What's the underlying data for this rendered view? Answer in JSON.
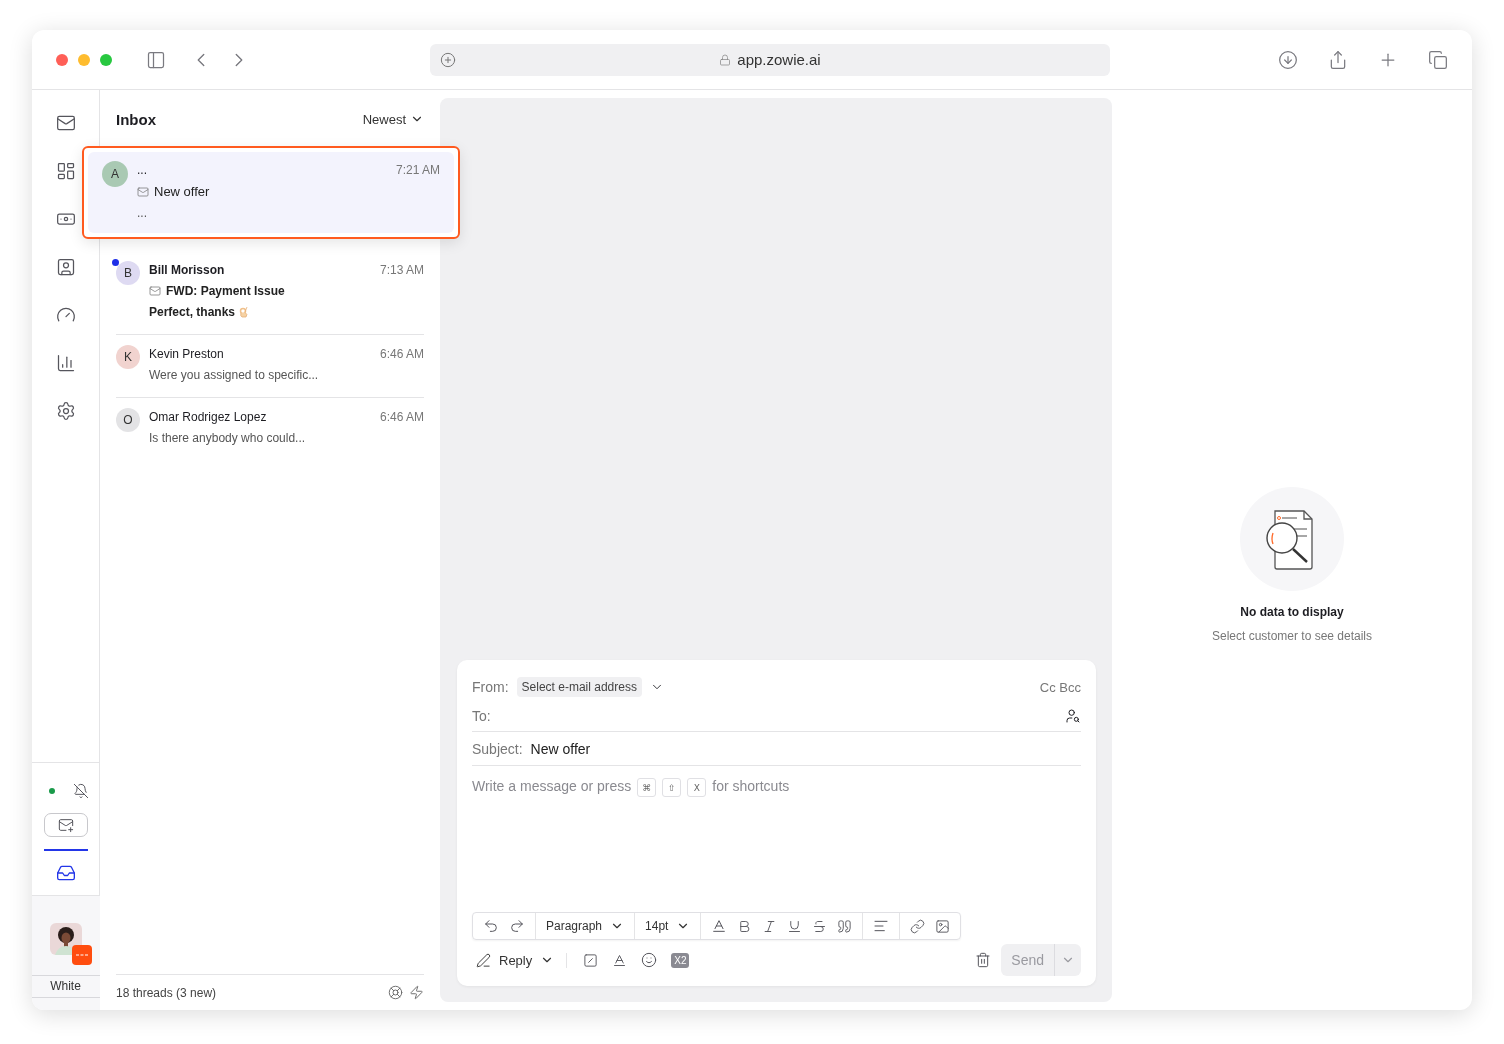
{
  "browser": {
    "url": "app.zowie.ai"
  },
  "rail": {
    "online": true,
    "inbox_tab": {
      "selected": true
    },
    "user": {
      "name": "White"
    }
  },
  "inbox": {
    "title": "Inbox",
    "sort": "Newest",
    "threads": [
      {
        "initial": "A",
        "color": "#a9c9b3",
        "name": "...",
        "subject": "New offer",
        "preview": "...",
        "time": "7:21 AM",
        "selected": true,
        "unread": false
      },
      {
        "initial": "B",
        "color": "#dedaf2",
        "name": "Bill Morisson",
        "subject": "FWD: Payment Issue",
        "preview": "Perfect, thanks",
        "time": "7:13 AM",
        "selected": false,
        "unread": true
      },
      {
        "initial": "K",
        "color": "#f1d3cf",
        "name": "Kevin Preston",
        "preview": "Were you assigned to specific...",
        "time": "6:46 AM",
        "selected": false,
        "unread": false
      },
      {
        "initial": "O",
        "color": "#e3e3e5",
        "name": "Omar Rodrigez Lopez",
        "preview": "Is there anybody who could...",
        "time": "6:46 AM",
        "selected": false,
        "unread": false
      }
    ],
    "footer": "18 threads (3 new)"
  },
  "composer": {
    "from_label": "From:",
    "from_placeholder": "Select e-mail address",
    "cc": "Cc",
    "bcc": "Bcc",
    "to_label": "To:",
    "subject_label": "Subject:",
    "subject": "New offer",
    "body_placeholder": "Write a message or press",
    "keys": [
      "⌘",
      "⇧",
      "X"
    ],
    "body_placeholder_after": "for shortcuts",
    "block_style": "Paragraph",
    "font_size": "14pt",
    "reply": "Reply",
    "variable_badge": "X2",
    "send": {
      "label": "Send",
      "disabled": true
    }
  },
  "details": {
    "title": "No data to display",
    "subtitle": "Select customer to see details"
  }
}
